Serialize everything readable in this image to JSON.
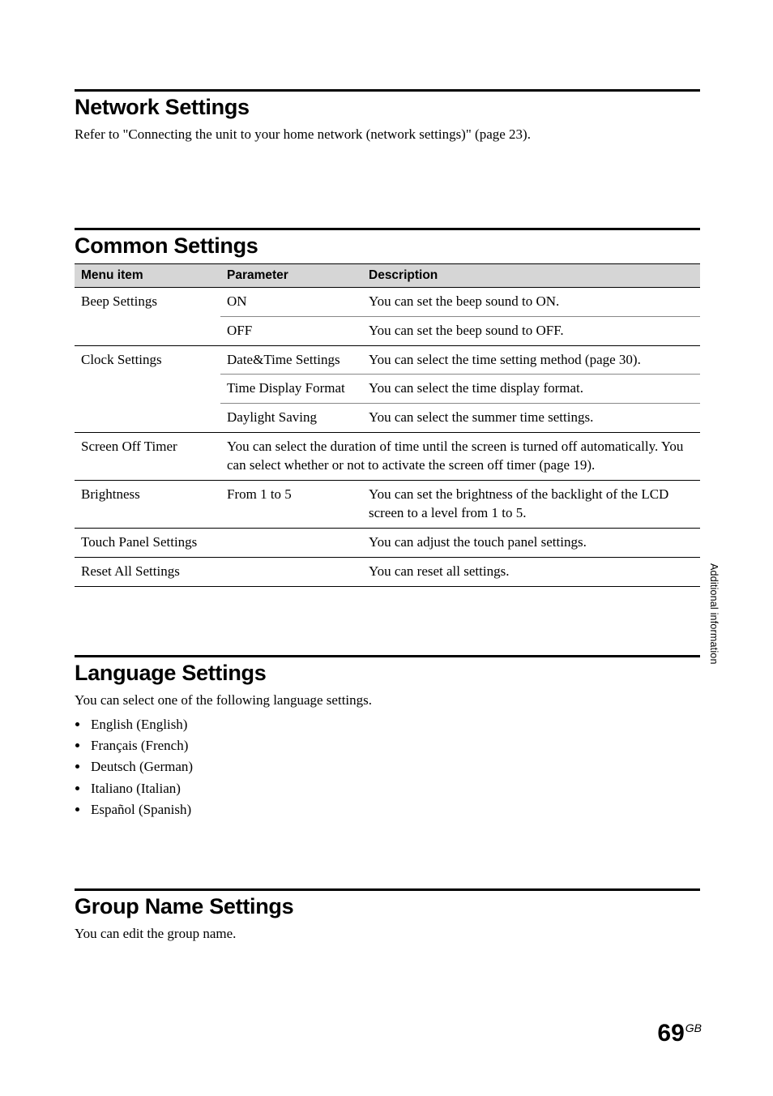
{
  "section_network": {
    "heading": "Network Settings",
    "body": "Refer to \"Connecting the unit to your home network (network settings)\" (page 23)."
  },
  "section_common": {
    "heading": "Common Settings",
    "headers": {
      "menu": "Menu item",
      "param": "Parameter",
      "desc": "Description"
    },
    "rows": {
      "beep_label": "Beep Settings",
      "beep_on_param": "ON",
      "beep_on_desc": "You can set the beep sound to ON.",
      "beep_off_param": "OFF",
      "beep_off_desc": "You can set the beep sound to OFF.",
      "clock_label": "Clock Settings",
      "clock_dt_param": "Date&Time Settings",
      "clock_dt_desc": "You can select the time setting method (page 30).",
      "clock_fmt_param": "Time Display Format",
      "clock_fmt_desc": "You can select the time display format.",
      "clock_ds_param": "Daylight Saving",
      "clock_ds_desc": "You can select the summer time settings.",
      "screen_label": "Screen Off Timer",
      "screen_desc": "You can select the duration of time until the screen is turned off automatically. You can select whether or not to activate the screen off timer (page 19).",
      "bright_label": "Brightness",
      "bright_param": "From 1 to 5",
      "bright_desc": "You can set the brightness of the backlight of the LCD screen to a level from 1 to 5.",
      "touch_label": "Touch Panel Settings",
      "touch_desc": "You can adjust the touch panel settings.",
      "reset_label": "Reset All Settings",
      "reset_desc": "You can reset all settings."
    }
  },
  "section_language": {
    "heading": "Language Settings",
    "intro": "You can select one of the following language settings.",
    "items": {
      "0": "English (English)",
      "1": "Français (French)",
      "2": "Deutsch (German)",
      "3": "Italiano (Italian)",
      "4": "Español (Spanish)"
    }
  },
  "section_group": {
    "heading": "Group Name Settings",
    "body": "You can edit the group name."
  },
  "side_tab": "Additional information",
  "page_number": "69",
  "page_suffix": "GB"
}
